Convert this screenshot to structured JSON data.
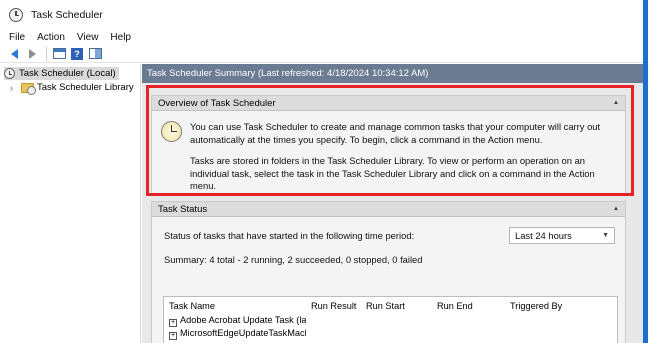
{
  "window": {
    "title": "Task Scheduler"
  },
  "menu": [
    "File",
    "Action",
    "View",
    "Help"
  ],
  "toolbar": {
    "icons": [
      "back-arrow-icon",
      "forward-arrow-icon",
      "show-hide-console-tree-icon",
      "help-icon",
      "show-hide-action-pane-icon"
    ],
    "help_glyph": "?"
  },
  "tree": {
    "root": "Task Scheduler (Local)",
    "library": "Task Scheduler Library",
    "expand_glyph": "›"
  },
  "main": {
    "header": "Task Scheduler Summary (Last refreshed: 4/18/2024 10:34:12 AM)",
    "overview": {
      "title": "Overview of Task Scheduler",
      "paragraph1": "You can use Task Scheduler to create and manage common tasks that your computer will carry out automatically at the times you specify. To begin, click a command in the Action menu.",
      "paragraph2": "Tasks are stored in folders in the Task Scheduler Library. To view or perform an operation on an individual task, select the task in the Task Scheduler Library and click on a command in the Action menu."
    },
    "status": {
      "title": "Task Status",
      "period_label": "Status of tasks that have started in the following time period:",
      "period_value": "Last 24 hours",
      "summary": "Summary: 4 total - 2 running, 2 succeeded, 0 stopped, 0 failed",
      "columns": [
        "Task Name",
        "Run Result",
        "Run Start",
        "Run End",
        "Triggered By"
      ],
      "rows": [
        {
          "name": "Adobe Acrobat Update Task (las..."
        },
        {
          "name": "MicrosoftEdgeUpdateTaskMach..."
        }
      ]
    }
  },
  "colors": {
    "header_bg": "#6b7c92",
    "highlight": "#e8202a",
    "desktop": "#1a6fd1"
  }
}
